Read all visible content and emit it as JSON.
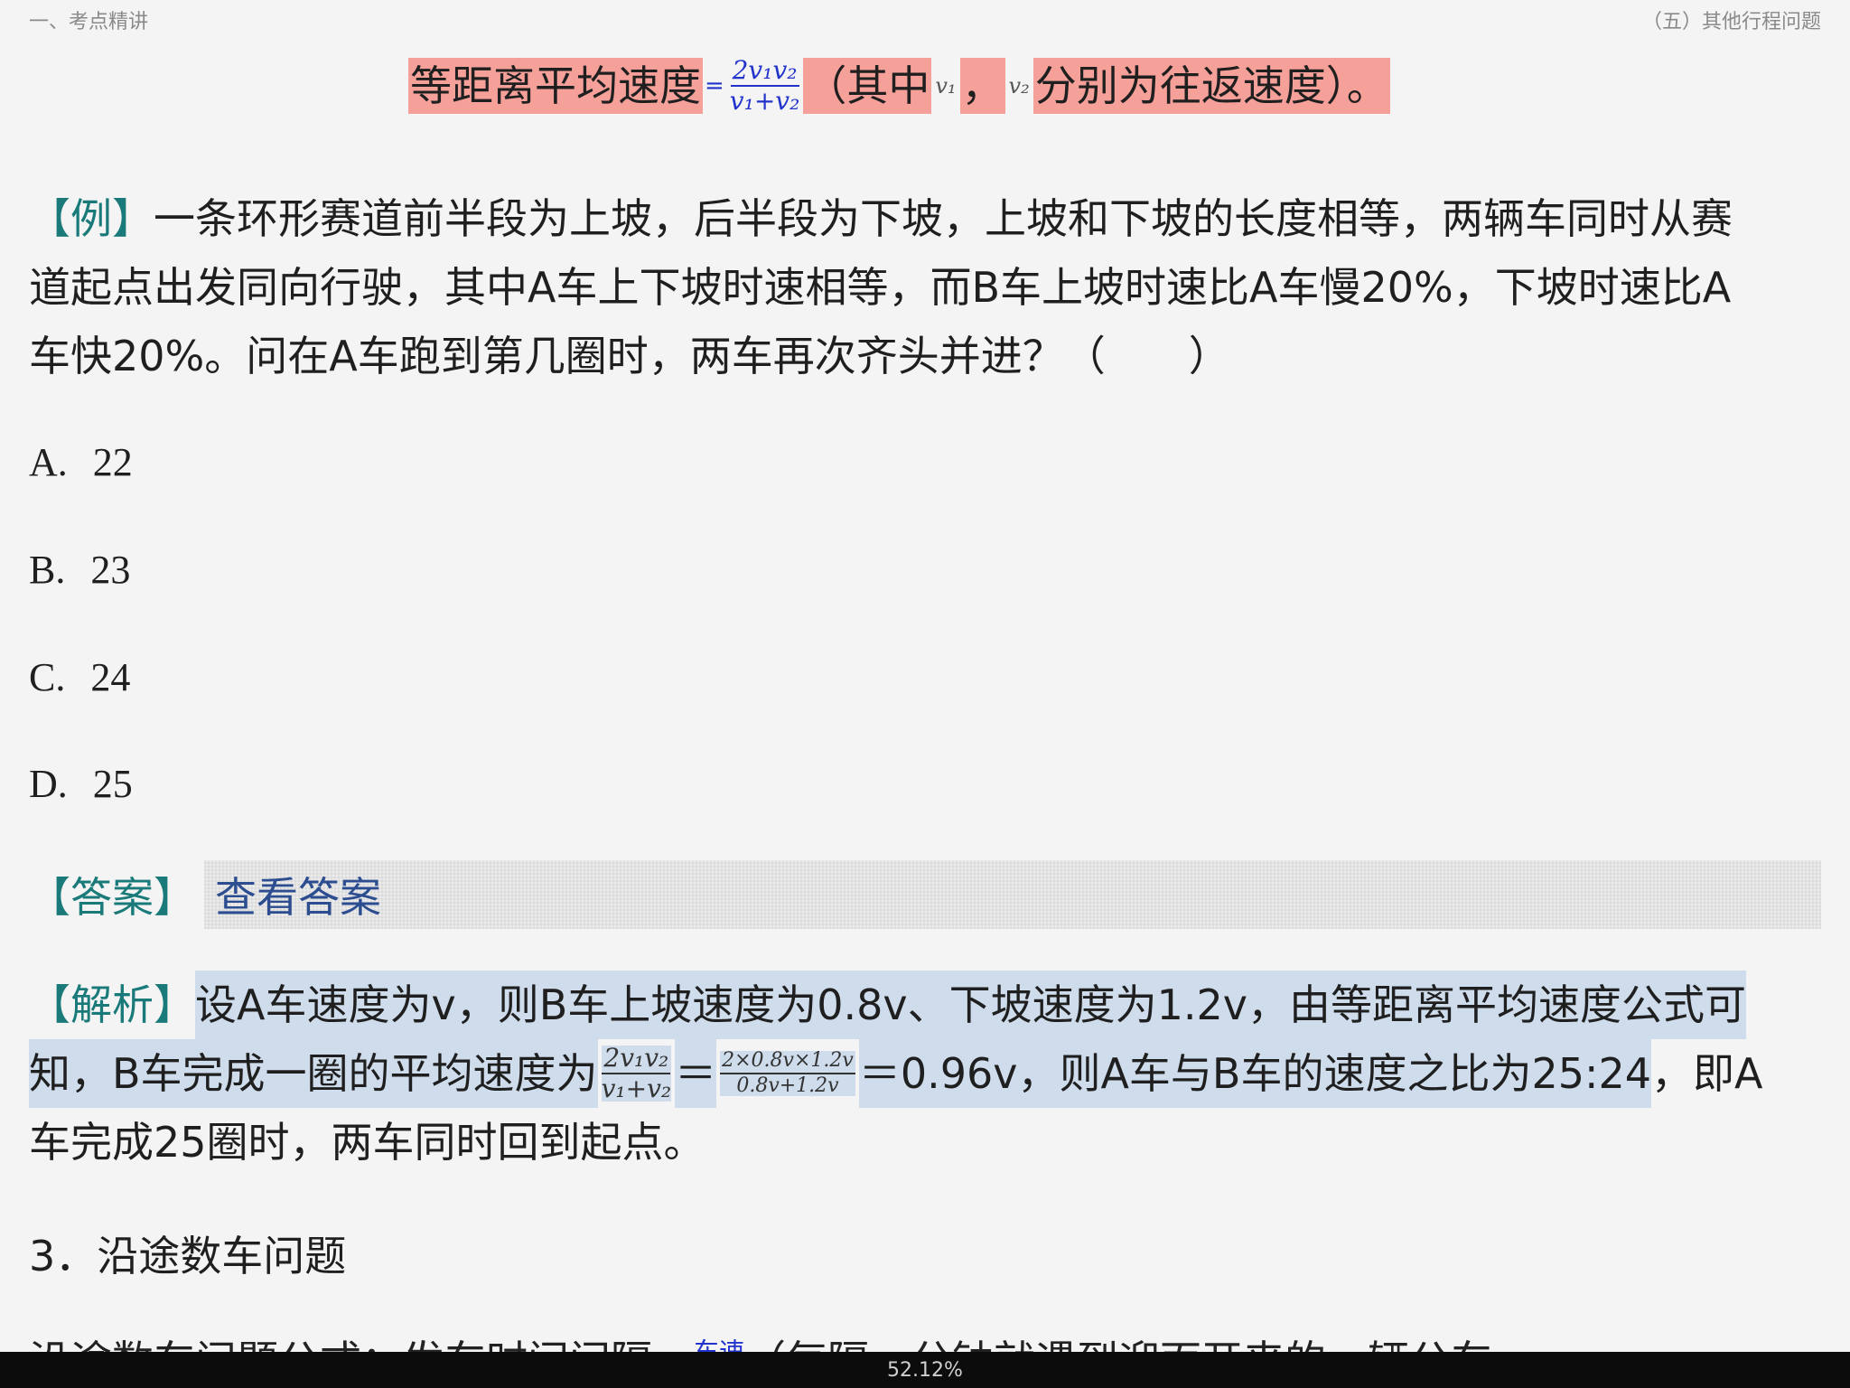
{
  "header": {
    "left": "一、考点精讲",
    "right": "（五）其他行程问题"
  },
  "formula": {
    "label": "等距离平均速度",
    "eq": "=",
    "numerator": "2v₁v₂",
    "denominator": "v₁+v₂",
    "paren_open": "（其中",
    "v1": "v₁",
    "comma": "，",
    "v2": "v₂",
    "rest": "分别为往返速度）。"
  },
  "example": {
    "tag": "【例】",
    "line1": "一条环形赛道前半段为上坡，后半段为下坡，上坡和下坡的长度相等，两辆车同时从赛",
    "line2": "道起点出发同向行驶，其中A车上下坡时速相等，而B车上坡时速比A车慢20%，下坡时速比A",
    "line3": "车快20%。问在A车跑到第几圈时，两车再次齐头并进？（　　）"
  },
  "options": [
    {
      "letter": "A.",
      "value": "22"
    },
    {
      "letter": "B.",
      "value": "23"
    },
    {
      "letter": "C.",
      "value": "24"
    },
    {
      "letter": "D.",
      "value": "25"
    }
  ],
  "answer": {
    "tag": "【答案】",
    "button": "查看答案"
  },
  "analysis": {
    "tag": "【解析】",
    "line1": "设A车速度为v，则B车上坡速度为0.8v、下坡速度为1.2v，由等距离平均速度公式可",
    "line2_a": "知，B车完成一圈的平均速度为",
    "frac1_num": "2v₁v₂",
    "frac1_den": "v₁+v₂",
    "eq": "＝",
    "frac2_num": "2×0.8v×1.2v",
    "frac2_den": "0.8v+1.2v",
    "line2_b": "＝0.96v，则A车与B车的速度之比为25:24",
    "line2_c": "，即A",
    "line3": "车完成25圈时，两车同时回到起点。"
  },
  "section3": {
    "title": "3．沿途数车问题"
  },
  "cut": {
    "left": "沿途数车问题公式：发车时间间隔＝",
    "mid": "车速",
    "right": "（每隔一分钟就遇到迎面开来的一辆公车"
  },
  "status": {
    "zoom": "52.12%"
  }
}
